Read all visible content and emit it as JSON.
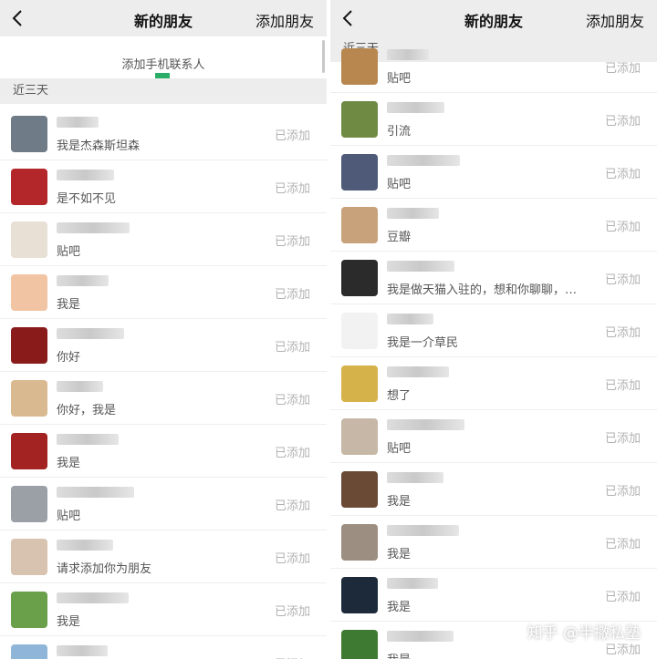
{
  "left": {
    "nav": {
      "title": "新的朋友",
      "action": "添加朋友"
    },
    "add_phone": "添加手机联系人",
    "section": "近三天",
    "rows": [
      {
        "msg": "我是杰森斯坦森",
        "status": "已添加",
        "color": "#6f7b86"
      },
      {
        "msg": "是不如不见",
        "status": "已添加",
        "color": "#b3262a"
      },
      {
        "msg": "贴吧",
        "status": "已添加",
        "color": "#e8dfd5"
      },
      {
        "msg": "我是",
        "status": "已添加",
        "color": "#f1c4a4"
      },
      {
        "msg": "你好",
        "status": "已添加",
        "color": "#8a1b1b"
      },
      {
        "msg": "你好，我是",
        "status": "已添加",
        "color": "#d9b98f"
      },
      {
        "msg": "我是",
        "status": "已添加",
        "color": "#a32323"
      },
      {
        "msg": "贴吧",
        "status": "已添加",
        "color": "#9aa0a6"
      },
      {
        "msg": "请求添加你为朋友",
        "status": "已添加",
        "color": "#d8c2b0"
      },
      {
        "msg": "我是",
        "status": "已添加",
        "color": "#6aa04a"
      },
      {
        "msg": "",
        "status": "已添加",
        "color": "#8fb6d8"
      }
    ]
  },
  "right": {
    "nav": {
      "title": "新的朋友",
      "action": "添加朋友"
    },
    "section": "近三天",
    "rows": [
      {
        "msg": "贴吧",
        "status": "已添加",
        "color": "#b8874f"
      },
      {
        "msg": "引流",
        "status": "已添加",
        "color": "#6e8a43"
      },
      {
        "msg": "贴吧",
        "status": "已添加",
        "color": "#4e5a78"
      },
      {
        "msg": "豆瓣",
        "status": "已添加",
        "color": "#c8a27a"
      },
      {
        "msg": "我是做天猫入驻的，想和你聊聊，…",
        "status": "已添加",
        "color": "#2b2b2b"
      },
      {
        "msg": "我是一介草民",
        "status": "已添加",
        "color": "#f2f2f2"
      },
      {
        "msg": "想了",
        "status": "已添加",
        "color": "#d6b24a"
      },
      {
        "msg": "贴吧",
        "status": "已添加",
        "color": "#c7b7a6"
      },
      {
        "msg": "我是",
        "status": "已添加",
        "color": "#6b4a35"
      },
      {
        "msg": "我是",
        "status": "已添加",
        "color": "#9c8e80"
      },
      {
        "msg": "我是",
        "status": "已添加",
        "color": "#1c2a3a"
      },
      {
        "msg": "我是",
        "status": "已添加",
        "color": "#3f7a32"
      }
    ],
    "watermark": "知乎 @半撒私塾"
  }
}
